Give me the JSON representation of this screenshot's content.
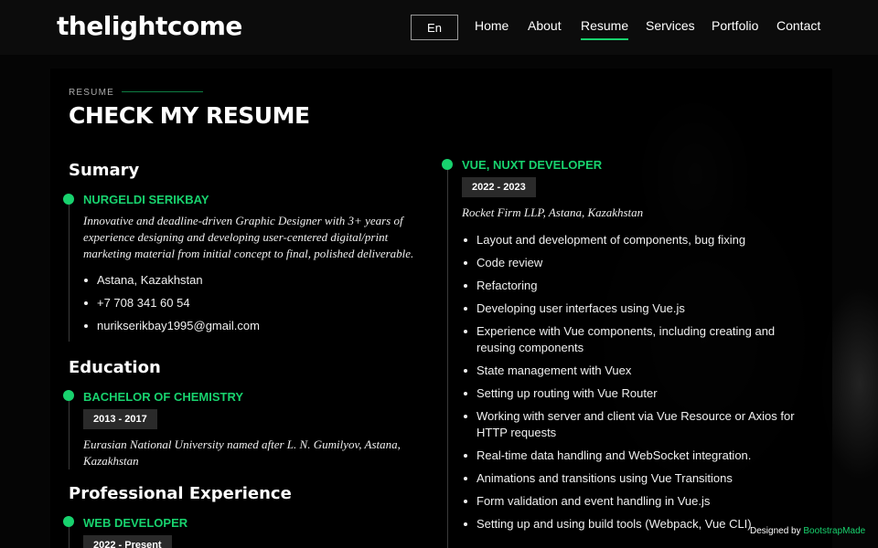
{
  "header": {
    "logo": "thelightcome",
    "language": "En",
    "nav": [
      "Home",
      "About",
      "Resume",
      "Services",
      "Portfolio",
      "Contact"
    ],
    "active_nav": "Resume"
  },
  "section": {
    "label": "RESUME",
    "title": "CHECK MY RESUME"
  },
  "summary": {
    "heading": "Sumary",
    "name": "NURGELDI SERIKBAY",
    "bio": "Innovative and deadline-driven Graphic Designer with 3+ years of experience designing and developing user-centered digital/print marketing material from initial concept to final, polished deliverable.",
    "contacts": [
      "Astana, Kazakhstan",
      "+7 708 341 60 54",
      "nurikserikbay1995@gmail.com"
    ]
  },
  "education": {
    "heading": "Education",
    "degree": "BACHELOR OF CHEMISTRY",
    "years": "2013 - 2017",
    "school": "Eurasian National University named after L. N. Gumilyov, Astana, Kazakhstan"
  },
  "professional": {
    "heading": "Professional Experience",
    "role": "WEB DEVELOPER",
    "years": "2022 - Present"
  },
  "vue_job": {
    "role": "VUE, NUXT DEVELOPER",
    "years": "2022 - 2023",
    "company": "Rocket Firm LLP, Astana, Kazakhstan",
    "duties": [
      "Layout and development of components, bug fixing",
      "Code review",
      "Refactoring",
      "Developing user interfaces using Vue.js",
      "Experience with Vue components, including creating and reusing components",
      "State management with Vuex",
      "Setting up routing with Vue Router",
      "Working with server and client via Vue Resource or Axios for HTTP requests",
      "Real-time data handling and WebSocket integration.",
      "Animations and transitions using Vue Transitions",
      "Form validation and event handling in Vue.js",
      "Setting up and using build tools (Webpack, Vue CLI)"
    ]
  },
  "credits": {
    "prefix": "Designed by",
    "link": "BootstrapMade"
  },
  "colors": {
    "accent": "#18d26e",
    "background": "#050505",
    "date_badge": "#2a2a2a"
  }
}
